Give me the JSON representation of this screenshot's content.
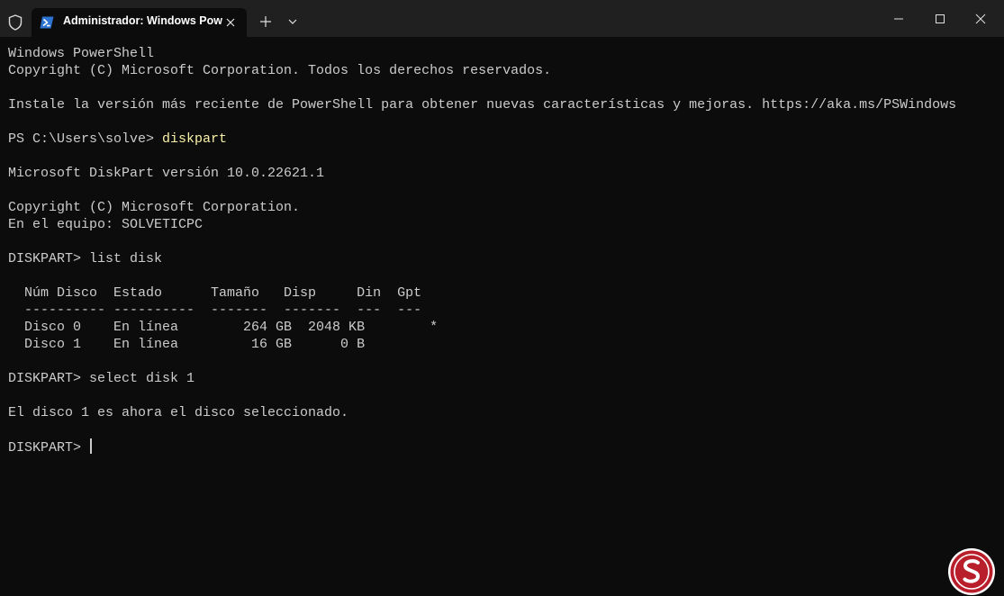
{
  "tab": {
    "title": "Administrador: Windows Pow"
  },
  "colors": {
    "background": "#0c0c0c",
    "titlebar": "#202020",
    "text": "#cccccc",
    "command": "#f9f1a5"
  },
  "icons": {
    "admin": "shield-icon",
    "shell": "powershell-icon",
    "tab_close": "close-icon",
    "new_tab": "plus-icon",
    "menu": "chevron-down-icon",
    "minimize": "minimize-icon",
    "maximize": "maximize-icon",
    "close": "close-icon",
    "logo": "solvetic-logo-icon"
  },
  "console": {
    "lines": [
      {
        "text": "Windows PowerShell"
      },
      {
        "text": "Copyright (C) Microsoft Corporation. Todos los derechos reservados."
      },
      {
        "text": ""
      },
      {
        "text": "Instale la versión más reciente de PowerShell para obtener nuevas características y mejoras. https://aka.ms/PSWindows"
      },
      {
        "text": ""
      },
      {
        "prompt": "PS C:\\Users\\solve> ",
        "command": "diskpart"
      },
      {
        "text": ""
      },
      {
        "text": "Microsoft DiskPart versión 10.0.22621.1"
      },
      {
        "text": ""
      },
      {
        "text": "Copyright (C) Microsoft Corporation."
      },
      {
        "text": "En el equipo: SOLVETICPC"
      },
      {
        "text": ""
      },
      {
        "text": "DISKPART> list disk"
      },
      {
        "text": ""
      },
      {
        "text": "  Núm Disco  Estado      Tamaño   Disp     Din  Gpt"
      },
      {
        "text": "  ---------- ----------  -------  -------  ---  ---"
      },
      {
        "text": "  Disco 0    En línea        264 GB  2048 KB        *"
      },
      {
        "text": "  Disco 1    En línea         16 GB      0 B"
      },
      {
        "text": ""
      },
      {
        "text": "DISKPART> select disk 1"
      },
      {
        "text": ""
      },
      {
        "text": "El disco 1 es ahora el disco seleccionado."
      },
      {
        "text": ""
      },
      {
        "text": "DISKPART> ",
        "cursor": true
      }
    ]
  }
}
